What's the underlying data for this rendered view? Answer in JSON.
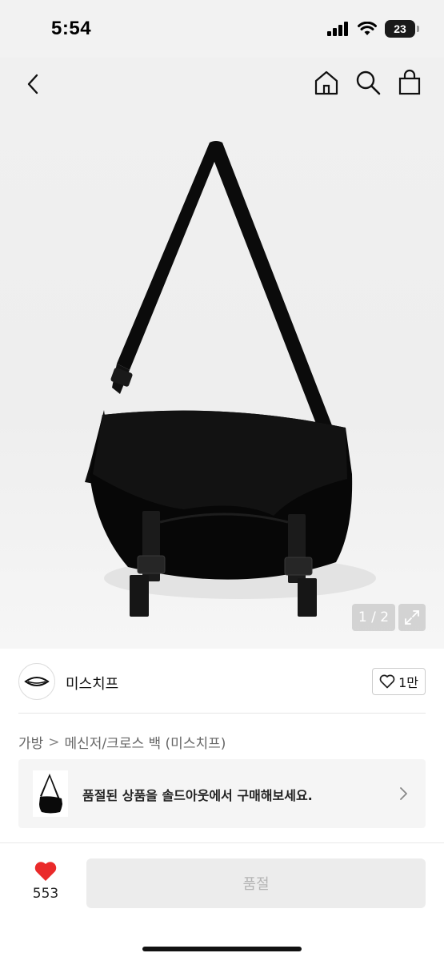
{
  "status_bar": {
    "time": "5:54",
    "battery": "23",
    "icons": [
      "signal-icon",
      "wifi-icon",
      "battery-icon"
    ]
  },
  "nav": {
    "icons": [
      "back-icon",
      "home-icon",
      "search-icon",
      "shopping-bag-icon"
    ]
  },
  "gallery": {
    "counter": "1 / 2",
    "expand_icon": "expand-icon"
  },
  "brand": {
    "name": "미스치프",
    "like_count": "1만",
    "like_icon": "heart-outline-icon"
  },
  "breadcrumb": {
    "category": "가방",
    "separator": ">",
    "subcategory": "메신저/크로스 백 (미스치프)"
  },
  "soldout_banner": {
    "text": "품절된 상품을 솔드아웃에서 구매해보세요."
  },
  "bottom_bar": {
    "like_count": "553",
    "button_label": "품절",
    "colors": {
      "heart": "#ea2a2a",
      "button_bg": "#ececec",
      "button_text": "#b4b4b4"
    }
  }
}
